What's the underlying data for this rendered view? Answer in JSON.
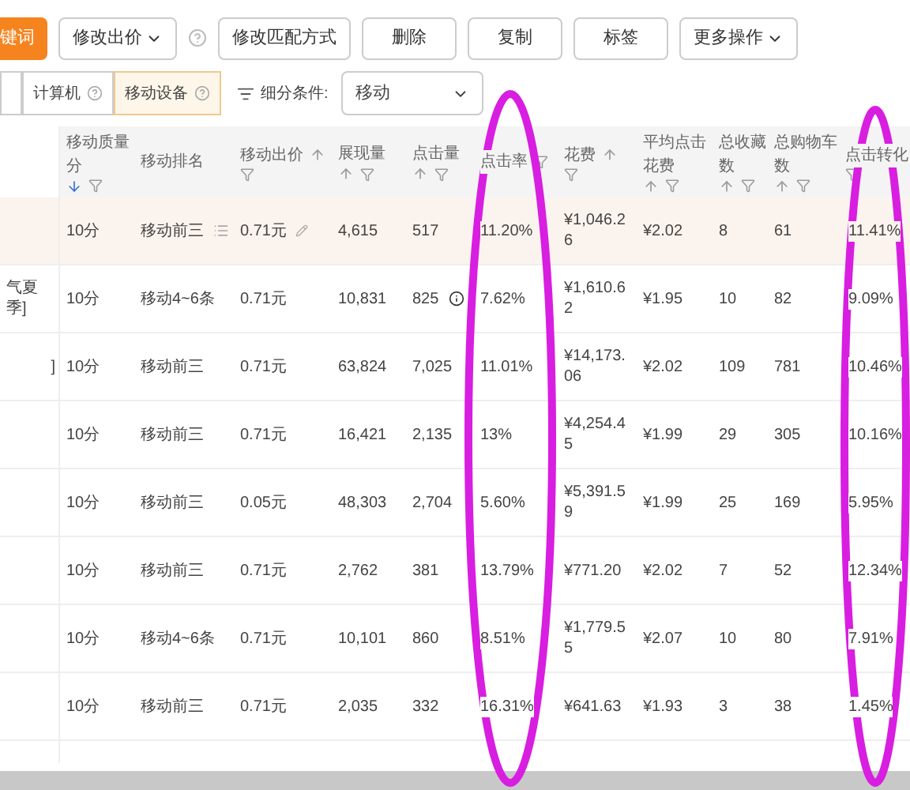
{
  "toolbar": [
    {
      "kind": "primary",
      "label": "键词"
    },
    {
      "kind": "dropdown",
      "label": "修改出价"
    },
    {
      "kind": "help"
    },
    {
      "kind": "plain",
      "label": "修改匹配方式"
    },
    {
      "kind": "plain",
      "label": "删除"
    },
    {
      "kind": "plain",
      "label": "复制"
    },
    {
      "kind": "plain",
      "label": "标签"
    },
    {
      "kind": "dropdown",
      "label": "更多操作"
    }
  ],
  "device_tabs": [
    {
      "selected": false
    },
    {
      "label": "计算机",
      "selected": false
    },
    {
      "label": "移动设备",
      "selected": true
    }
  ],
  "segment": {
    "label": "细分条件:",
    "value": "移动"
  },
  "table": {
    "columns": [
      {
        "sort_up": false,
        "sort_down": false,
        "filter": false
      },
      {
        "label": "移动质量分",
        "sort_up": false,
        "sort_down": true,
        "filter": true
      },
      {
        "label": "移动排名",
        "sort_up": false,
        "sort_down": false,
        "filter": false
      },
      {
        "label": "移动出价",
        "sort_up": true,
        "sort_down": false,
        "filter": true
      },
      {
        "label": "展现量",
        "sort_up": true,
        "sort_down": false,
        "filter": true
      },
      {
        "label": "点击量",
        "sort_up": true,
        "sort_down": false,
        "filter": true
      },
      {
        "label": "点击率",
        "sort_up": false,
        "sort_down": false,
        "filter": true
      },
      {
        "label": "花费",
        "sort_up": true,
        "sort_down": false,
        "filter": true
      },
      {
        "label": "平均点击花费",
        "sort_up": true,
        "sort_down": false,
        "filter": true
      },
      {
        "label": "总收藏数",
        "sort_up": true,
        "sort_down": false,
        "filter": true
      },
      {
        "label": "总购物车数",
        "sort_up": true,
        "sort_down": false,
        "filter": true
      },
      {
        "label": "点击转化",
        "sort_up": false,
        "sort_down": false,
        "filter": true
      }
    ],
    "rows": [
      {
        "selected": true,
        "cells": [
          "",
          "10分",
          {
            "text": "移动前三",
            "kind": "menu"
          },
          {
            "text": "0.71元",
            "kind": "editable"
          },
          "4,615",
          "517",
          "11.20%",
          "¥1,046.26",
          "¥2.02",
          "8",
          "61",
          "11.41%"
        ]
      },
      {
        "selected": false,
        "cells": [
          "气夏季]",
          "10分",
          "移动4~6条",
          "0.71元",
          "10,831",
          {
            "text": "825",
            "kind": "info"
          },
          "7.62%",
          "¥1,610.62",
          "¥1.95",
          "10",
          "82",
          "9.09%"
        ]
      },
      {
        "selected": false,
        "cells": [
          "]",
          "10分",
          "移动前三",
          "0.71元",
          "63,824",
          "7,025",
          "11.01%",
          "¥14,173.06",
          "¥2.02",
          "109",
          "781",
          "10.46%"
        ]
      },
      {
        "selected": false,
        "cells": [
          "",
          "10分",
          "移动前三",
          "0.71元",
          "16,421",
          "2,135",
          "13%",
          "¥4,254.45",
          "¥1.99",
          "29",
          "305",
          "10.16%"
        ]
      },
      {
        "selected": false,
        "cells": [
          "",
          "10分",
          "移动前三",
          "0.05元",
          "48,303",
          "2,704",
          "5.60%",
          "¥5,391.59",
          "¥1.99",
          "25",
          "169",
          "5.95%"
        ]
      },
      {
        "selected": false,
        "cells": [
          "",
          "10分",
          "移动前三",
          "0.71元",
          "2,762",
          "381",
          "13.79%",
          "¥771.20",
          "¥2.02",
          "7",
          "52",
          "12.34%"
        ]
      },
      {
        "selected": false,
        "cells": [
          "",
          "10分",
          "移动4~6条",
          "0.71元",
          "10,101",
          "860",
          "8.51%",
          "¥1,779.55",
          "¥2.07",
          "10",
          "80",
          "7.91%"
        ]
      },
      {
        "selected": false,
        "cells": [
          "",
          "10分",
          "移动前三",
          "0.71元",
          "2,035",
          "332",
          "16.31%",
          "¥641.63",
          "¥1.93",
          "3",
          "38",
          "1.45%"
        ]
      }
    ]
  }
}
